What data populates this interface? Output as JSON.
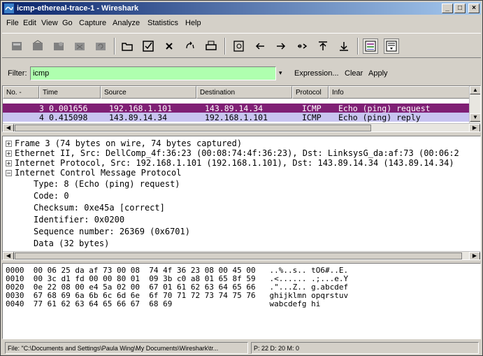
{
  "window": {
    "title": "icmp-ethereal-trace-1 - Wireshark",
    "min": "_",
    "max": "□",
    "close": "×"
  },
  "menu": [
    "File",
    "Edit",
    "View",
    "Go",
    "Capture",
    "Analyze",
    "Statistics",
    "Help"
  ],
  "filter": {
    "label": "Filter:",
    "value": "icmp",
    "dropdown": "▾",
    "expression": "Expression...",
    "clear": "Clear",
    "apply": "Apply"
  },
  "packet_list": {
    "columns": [
      "No. -",
      "Time",
      "Source",
      "Destination",
      "Protocol",
      "Info"
    ],
    "rows": [
      [
        "3",
        "0.001656",
        "192.168.1.101",
        "143.89.14.34",
        "ICMP",
        "Echo (ping) request"
      ],
      [
        "4",
        "0.415098",
        "143.89.14.34",
        "192.168.1.101",
        "ICMP",
        "Echo (ping) reply"
      ]
    ]
  },
  "details": {
    "lines": [
      {
        "exp": "+",
        "text": "Frame 3 (74 bytes on wire, 74 bytes captured)"
      },
      {
        "exp": "+",
        "text": "Ethernet II, Src: DellComp_4f:36:23 (00:08:74:4f:36:23), Dst: LinksysG_da:af:73 (00:06:2"
      },
      {
        "exp": "+",
        "text": "Internet Protocol, Src: 192.168.1.101 (192.168.1.101), Dst: 143.89.14.34 (143.89.14.34)"
      },
      {
        "exp": "−",
        "text": "Internet Control Message Protocol"
      },
      {
        "exp": "",
        "text": "Type: 8 (Echo (ping) request)"
      },
      {
        "exp": "",
        "text": "Code: 0"
      },
      {
        "exp": "",
        "text": "Checksum: 0xe45a [correct]"
      },
      {
        "exp": "",
        "text": "Identifier: 0x0200"
      },
      {
        "exp": "",
        "text": "Sequence number: 26369 (0x6701)"
      },
      {
        "exp": "",
        "text": "Data (32 bytes)"
      }
    ]
  },
  "hex": {
    "lines": [
      "0000  00 06 25 da af 73 00 08  74 4f 36 23 08 00 45 00   ..%..s.. tO6#..E.",
      "0010  00 3c d1 fd 00 00 80 01  09 3b c0 a8 01 65 8f 59   .<...... .;...e.Y",
      "0020  0e 22 08 00 e4 5a 02 00  67 01 61 62 63 64 65 66   .\"...Z.. g.abcdef",
      "0030  67 68 69 6a 6b 6c 6d 6e  6f 70 71 72 73 74 75 76   ghijklmn opqrstuv",
      "0040  77 61 62 63 64 65 66 67  68 69                     wabcdefg hi"
    ]
  },
  "status": {
    "file": "File: \"C:\\Documents and Settings\\Paula Wing\\My Documents\\Wireshark\\tr...",
    "packets": "P: 22 D: 20 M: 0"
  },
  "colors": {
    "selected_row": "#7f1f74",
    "other_row": "#c8c4f0",
    "filter_ok": "#afffaf"
  }
}
